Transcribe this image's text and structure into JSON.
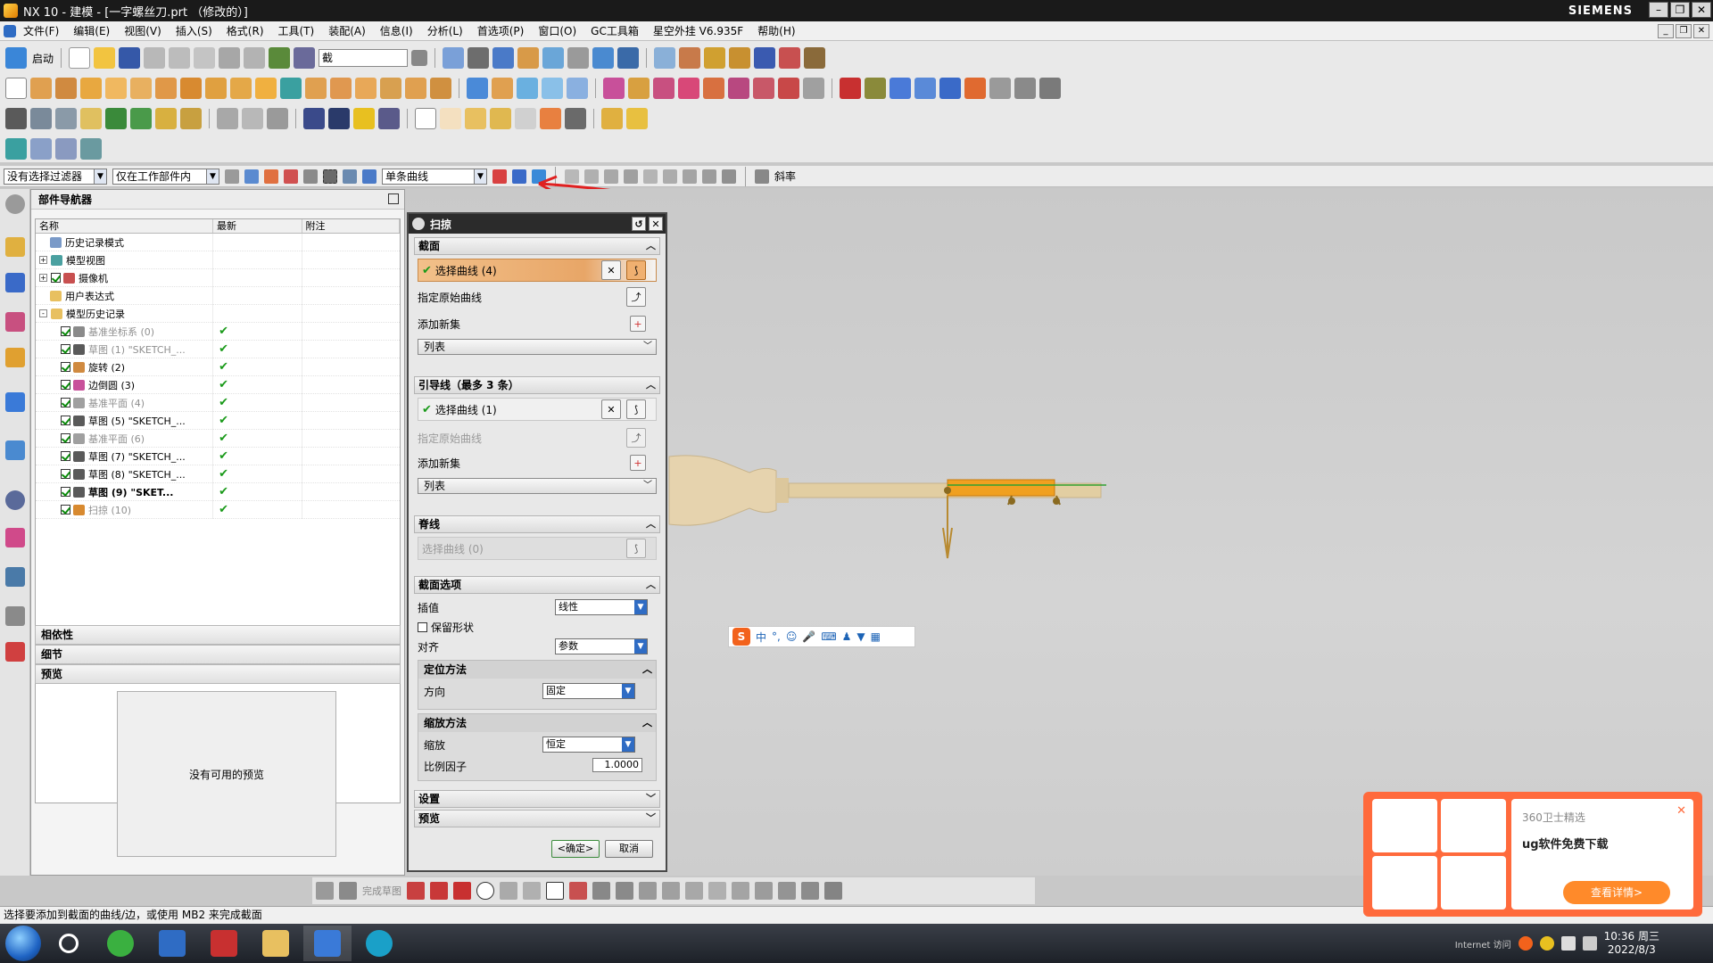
{
  "window": {
    "title": "NX 10 - 建模 - [一字螺丝刀.prt （修改的）]",
    "brand": "SIEMENS"
  },
  "menu": [
    "文件(F)",
    "编辑(E)",
    "视图(V)",
    "插入(S)",
    "格式(R)",
    "工具(T)",
    "装配(A)",
    "信息(I)",
    "分析(L)",
    "首选项(P)",
    "窗口(O)",
    "GC工具箱",
    "星空外挂 V6.935F",
    "帮助(H)"
  ],
  "toolbar": {
    "start_label": "启动",
    "search_value": "截"
  },
  "selection_bar": {
    "filter": "没有选择过滤器",
    "scope": "仅在工作部件内",
    "curve_rule": "单条曲线",
    "curvature_label": "斜率"
  },
  "navigator": {
    "title": "部件导航器",
    "columns": [
      "名称",
      "最新",
      "附注"
    ],
    "nodes": [
      {
        "label": "历史记录模式",
        "indent": 1,
        "expander": "",
        "check": false,
        "icon": "history-mode-icon",
        "style": "normal",
        "latest": ""
      },
      {
        "label": "模型视图",
        "indent": 0,
        "expander": "+",
        "check": false,
        "icon": "model-views-icon",
        "style": "normal",
        "latest": ""
      },
      {
        "label": "摄像机",
        "indent": 0,
        "expander": "+",
        "check": true,
        "icon": "camera-icon",
        "style": "normal",
        "latest": ""
      },
      {
        "label": "用户表达式",
        "indent": 1,
        "expander": "",
        "check": false,
        "icon": "folder-icon",
        "style": "normal",
        "latest": ""
      },
      {
        "label": "模型历史记录",
        "indent": 0,
        "expander": "-",
        "check": false,
        "icon": "folder-icon",
        "style": "normal",
        "latest": ""
      },
      {
        "label": "基准坐标系 (0)",
        "indent": 2,
        "expander": "",
        "check": true,
        "icon": "datum-csys-icon",
        "style": "dim",
        "latest": "✔"
      },
      {
        "label": "草图 (1) \"SKETCH_...",
        "indent": 2,
        "expander": "",
        "check": true,
        "icon": "sketch-icon",
        "style": "dim",
        "latest": "✔"
      },
      {
        "label": "旋转 (2)",
        "indent": 2,
        "expander": "",
        "check": true,
        "icon": "revolve-icon",
        "style": "normal",
        "latest": "✔"
      },
      {
        "label": "边倒圆 (3)",
        "indent": 2,
        "expander": "",
        "check": true,
        "icon": "edge-blend-icon",
        "style": "normal",
        "latest": "✔"
      },
      {
        "label": "基准平面 (4)",
        "indent": 2,
        "expander": "",
        "check": true,
        "icon": "datum-plane-icon",
        "style": "dim",
        "latest": "✔"
      },
      {
        "label": "草图 (5) \"SKETCH_...",
        "indent": 2,
        "expander": "",
        "check": true,
        "icon": "sketch-icon",
        "style": "normal",
        "latest": "✔"
      },
      {
        "label": "基准平面 (6)",
        "indent": 2,
        "expander": "",
        "check": true,
        "icon": "datum-plane-icon",
        "style": "dim",
        "latest": "✔"
      },
      {
        "label": "草图 (7) \"SKETCH_...",
        "indent": 2,
        "expander": "",
        "check": true,
        "icon": "sketch-icon",
        "style": "normal",
        "latest": "✔"
      },
      {
        "label": "草图 (8) \"SKETCH_...",
        "indent": 2,
        "expander": "",
        "check": true,
        "icon": "sketch-icon",
        "style": "normal",
        "latest": "✔"
      },
      {
        "label": "草图 (9) \"SKET...",
        "indent": 2,
        "expander": "",
        "check": true,
        "icon": "sketch-icon",
        "style": "bold",
        "latest": "✔"
      },
      {
        "label": "扫掠 (10)",
        "indent": 2,
        "expander": "",
        "check": true,
        "icon": "sweep-icon",
        "style": "dim",
        "latest": "✔"
      }
    ],
    "sections": [
      "相依性",
      "细节",
      "预览"
    ],
    "preview_text": "没有可用的预览"
  },
  "dialog": {
    "title": "扫掠",
    "section": {
      "title": "截面",
      "select_curve": "选择曲线 (4)",
      "specify_origin": "指定原始曲线",
      "add_new_set": "添加新集",
      "list": "列表"
    },
    "guides": {
      "title": "引导线（最多 3 条）",
      "select_curve": "选择曲线 (1)",
      "specify_origin": "指定原始曲线",
      "add_new_set": "添加新集",
      "list": "列表"
    },
    "spine": {
      "title": "脊线",
      "select_curve": "选择曲线 (0)"
    },
    "section_options": {
      "title": "截面选项",
      "interp_label": "插值",
      "interp_value": "线性",
      "preserve_shape": "保留形状",
      "preserve_checked": false,
      "align_label": "对齐",
      "align_value": "参数",
      "orientation": {
        "title": "定位方法",
        "dir_label": "方向",
        "dir_value": "固定"
      },
      "scaling": {
        "title": "缩放方法",
        "scale_label": "缩放",
        "scale_value": "恒定",
        "factor_label": "比例因子",
        "factor_value": "1.0000"
      }
    },
    "settings_title": "设置",
    "preview_title": "预览",
    "ok_label": "<确定>",
    "cancel_label": "取消"
  },
  "sketch_toolbar": {
    "finish_label": "完成草图"
  },
  "status_text": "选择要添加到截面的曲线/边，或使用 MB2 来完成截面",
  "taskbar": {
    "time": "10:36 周三",
    "date": "2022/8/3",
    "internet": "Internet 访问"
  },
  "popup": {
    "source": "360卫士精选",
    "headline": "ug软件免费下载",
    "cta": "查看详情>"
  },
  "colors": {
    "accent_orange": "#e8a667",
    "check_green": "#1a9a1a",
    "annotation_red": "#e02020",
    "model_body": "#e6d3ae",
    "model_orange": "#f0a020"
  }
}
